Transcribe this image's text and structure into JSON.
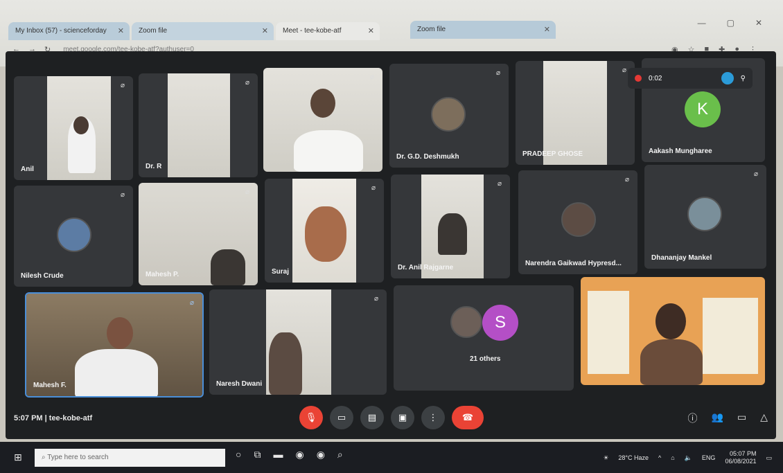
{
  "browser": {
    "tabs": [
      {
        "label": "My Inbox (57) - scienceforday"
      },
      {
        "label": "Zoom file"
      },
      {
        "label": "Meet - tee-kobe-atf"
      },
      {
        "label": "Zoom file"
      }
    ],
    "url": "meet.google.com/tee-kobe-atf?authuser=0"
  },
  "recording": {
    "label": "0:02"
  },
  "participants": [
    {
      "name": "Anil"
    },
    {
      "name": "Dr. R"
    },
    {
      "name": ""
    },
    {
      "name": "Dr. G.D. Deshmukh"
    },
    {
      "name": "PRADEEP GHOSE"
    },
    {
      "name": "Aakash Mungharee",
      "initial": "K"
    },
    {
      "name": "Nilesh Crude"
    },
    {
      "name": "Mahesh P."
    },
    {
      "name": "Suraj"
    },
    {
      "name": "Dr. Anil Rajgarne"
    },
    {
      "name": "Narendra Gaikwad Hypresd..."
    },
    {
      "name": "Dhananjay Mankel"
    },
    {
      "name": "Mahesh F."
    },
    {
      "name": "Naresh Dwani"
    },
    {
      "name": "21 others",
      "initial": "S"
    },
    {
      "name": ""
    }
  ],
  "meet": {
    "time": "5:07 PM",
    "meeting_code": "tee-kobe-atf"
  },
  "taskbar": {
    "search_placeholder": "Type here to search",
    "weather": "28°C Haze",
    "language": "ENG",
    "time": "05:07 PM",
    "date": "06/08/2021"
  },
  "colors": {
    "letter_k": "#6abf4b",
    "letter_s": "#b44fc6",
    "end_call": "#ea4335"
  }
}
